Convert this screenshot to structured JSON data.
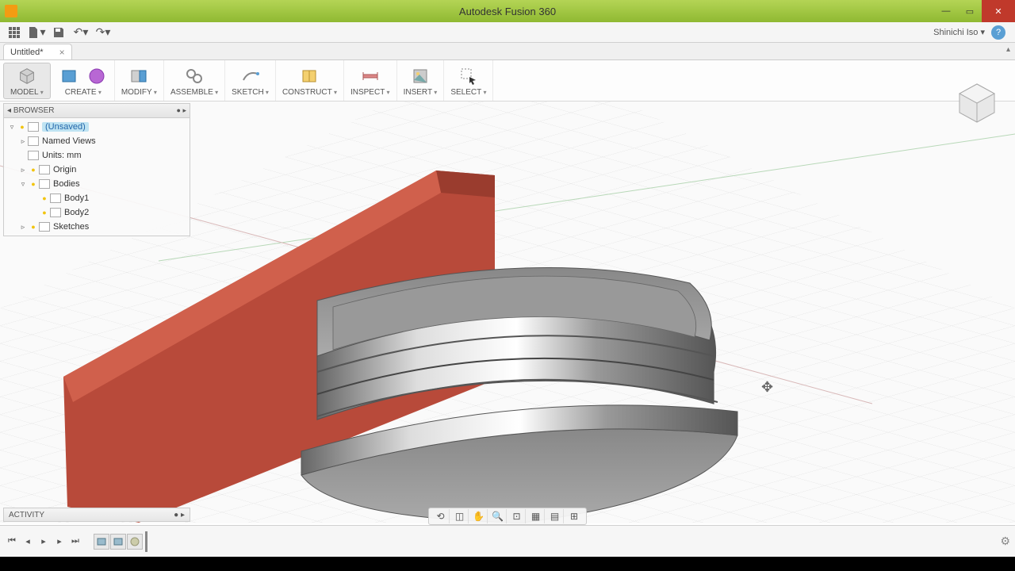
{
  "title": "Autodesk Fusion 360",
  "user": "Shinichi Iso ▾",
  "doc_tab": "Untitled*",
  "ribbon": {
    "workspace": "MODEL",
    "groups": [
      "CREATE",
      "MODIFY",
      "ASSEMBLE",
      "SKETCH",
      "CONSTRUCT",
      "INSPECT",
      "INSERT",
      "SELECT"
    ]
  },
  "browser": {
    "header": "BROWSER",
    "root": "(Unsaved)",
    "named_views": "Named Views",
    "units": "Units: mm",
    "origin": "Origin",
    "bodies": "Bodies",
    "body1": "Body1",
    "body2": "Body2",
    "sketches": "Sketches"
  },
  "activity": "ACTIVITY"
}
